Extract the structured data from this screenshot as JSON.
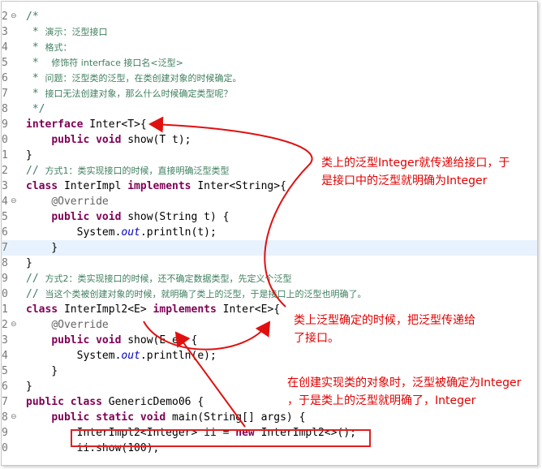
{
  "editor": {
    "lines": [
      {
        "n": "2",
        "fold": "⊖",
        "segs": [
          {
            "t": "/*",
            "c": "cmt"
          }
        ]
      },
      {
        "n": "3",
        "segs": [
          {
            "t": " * ",
            "c": "cmt"
          },
          {
            "t": "演示：泛型接口",
            "c": "cmtzh"
          }
        ]
      },
      {
        "n": "4",
        "segs": [
          {
            "t": " * ",
            "c": "cmt"
          },
          {
            "t": "格式：",
            "c": "cmtzh"
          }
        ]
      },
      {
        "n": "5",
        "segs": [
          {
            "t": " *  ",
            "c": "cmt"
          },
          {
            "t": "修饰符 interface 接口名<泛型>",
            "c": "cmtzh"
          }
        ]
      },
      {
        "n": "6",
        "segs": [
          {
            "t": " * ",
            "c": "cmt"
          },
          {
            "t": "问题：泛型类的泛型，在类创建对象的时候确定。",
            "c": "cmtzh"
          }
        ]
      },
      {
        "n": "7",
        "segs": [
          {
            "t": " * ",
            "c": "cmt"
          },
          {
            "t": "接口无法创建对象，那么什么时候确定类型呢？",
            "c": "cmtzh"
          }
        ]
      },
      {
        "n": "8",
        "segs": [
          {
            "t": " */",
            "c": "cmt"
          }
        ]
      },
      {
        "n": "9",
        "segs": [
          {
            "t": "interface",
            "c": "kw"
          },
          {
            "t": " Inter<T>{"
          }
        ]
      },
      {
        "n": "0",
        "segs": [
          {
            "t": "    "
          },
          {
            "t": "public void",
            "c": "kw"
          },
          {
            "t": " show(T t);"
          }
        ]
      },
      {
        "n": "1",
        "segs": [
          {
            "t": "}"
          }
        ]
      },
      {
        "n": "2",
        "segs": [
          {
            "t": "// ",
            "c": "cmt"
          },
          {
            "t": "方式1：类实现接口的时候，直接明确泛型类型",
            "c": "cmtzh"
          }
        ]
      },
      {
        "n": "3",
        "segs": [
          {
            "t": "class",
            "c": "kw"
          },
          {
            "t": " InterImpl "
          },
          {
            "t": "implements",
            "c": "kw"
          },
          {
            "t": " Inter<String>{"
          }
        ]
      },
      {
        "n": "4",
        "fold": "⊖",
        "segs": [
          {
            "t": "    "
          },
          {
            "t": "@Override",
            "c": "ann"
          }
        ]
      },
      {
        "n": "5",
        "segs": [
          {
            "t": "    "
          },
          {
            "t": "public void",
            "c": "kw"
          },
          {
            "t": " show(String t) {"
          }
        ]
      },
      {
        "n": "6",
        "segs": [
          {
            "t": "        System."
          },
          {
            "t": "out",
            "c": "ital"
          },
          {
            "t": ".println(t);"
          }
        ]
      },
      {
        "n": "7",
        "hl": true,
        "segs": [
          {
            "t": "    }"
          }
        ]
      },
      {
        "n": "8",
        "segs": [
          {
            "t": "}"
          }
        ]
      },
      {
        "n": "9",
        "segs": [
          {
            "t": "// ",
            "c": "cmt"
          },
          {
            "t": "方式2：类实现接口的时候，还不确定数据类型，先定义个泛型",
            "c": "cmtzh"
          }
        ]
      },
      {
        "n": "0",
        "segs": [
          {
            "t": "// ",
            "c": "cmt"
          },
          {
            "t": "当这个类被创建对象的时候，就明确了类上的泛型，于是接口上的泛型也明确了。",
            "c": "cmtzh"
          }
        ]
      },
      {
        "n": "1",
        "segs": [
          {
            "t": "class",
            "c": "kw"
          },
          {
            "t": " InterImpl2<E> "
          },
          {
            "t": "implements",
            "c": "kw"
          },
          {
            "t": " Inter<E>{"
          }
        ]
      },
      {
        "n": "2",
        "fold": "⊖",
        "segs": [
          {
            "t": "    "
          },
          {
            "t": "@Override",
            "c": "ann"
          }
        ]
      },
      {
        "n": "3",
        "segs": [
          {
            "t": "    "
          },
          {
            "t": "public void",
            "c": "kw"
          },
          {
            "t": " show(E e) {"
          }
        ]
      },
      {
        "n": "4",
        "segs": [
          {
            "t": "        System."
          },
          {
            "t": "out",
            "c": "ital"
          },
          {
            "t": ".println(e);"
          }
        ]
      },
      {
        "n": "5",
        "segs": [
          {
            "t": "    }"
          }
        ]
      },
      {
        "n": "6",
        "segs": [
          {
            "t": "}"
          }
        ]
      },
      {
        "n": "7",
        "segs": [
          {
            "t": "public class",
            "c": "kw"
          },
          {
            "t": " GenericDemo06 {"
          }
        ]
      },
      {
        "n": "8",
        "fold": "⊖",
        "segs": [
          {
            "t": "    "
          },
          {
            "t": "public static void",
            "c": "kw"
          },
          {
            "t": " main(String[] args) {"
          }
        ]
      },
      {
        "n": "9",
        "segs": [
          {
            "t": "        InterImpl2<Integer> ii = "
          },
          {
            "t": "new",
            "c": "kw"
          },
          {
            "t": " InterImpl2<>();"
          }
        ]
      },
      {
        "n": "0",
        "segs": [
          {
            "t": "        ii.show(100);"
          }
        ]
      }
    ]
  },
  "notes": {
    "note1_line1": "类上的泛型Integer就传递给接口，于",
    "note1_line2": "是接口中的泛型就明确为Integer",
    "note2_line1": "类上泛型确定的时候，把泛型传递给",
    "note2_line2": "了接口。",
    "note3_line1": "在创建实现类的对象时，泛型被确定为Integer",
    "note3_line2": "，于是类上的泛型就明确了，Integer"
  },
  "colors": {
    "arrow": "#e01010",
    "keyword": "#7f0055",
    "comment": "#3f7f5f"
  }
}
